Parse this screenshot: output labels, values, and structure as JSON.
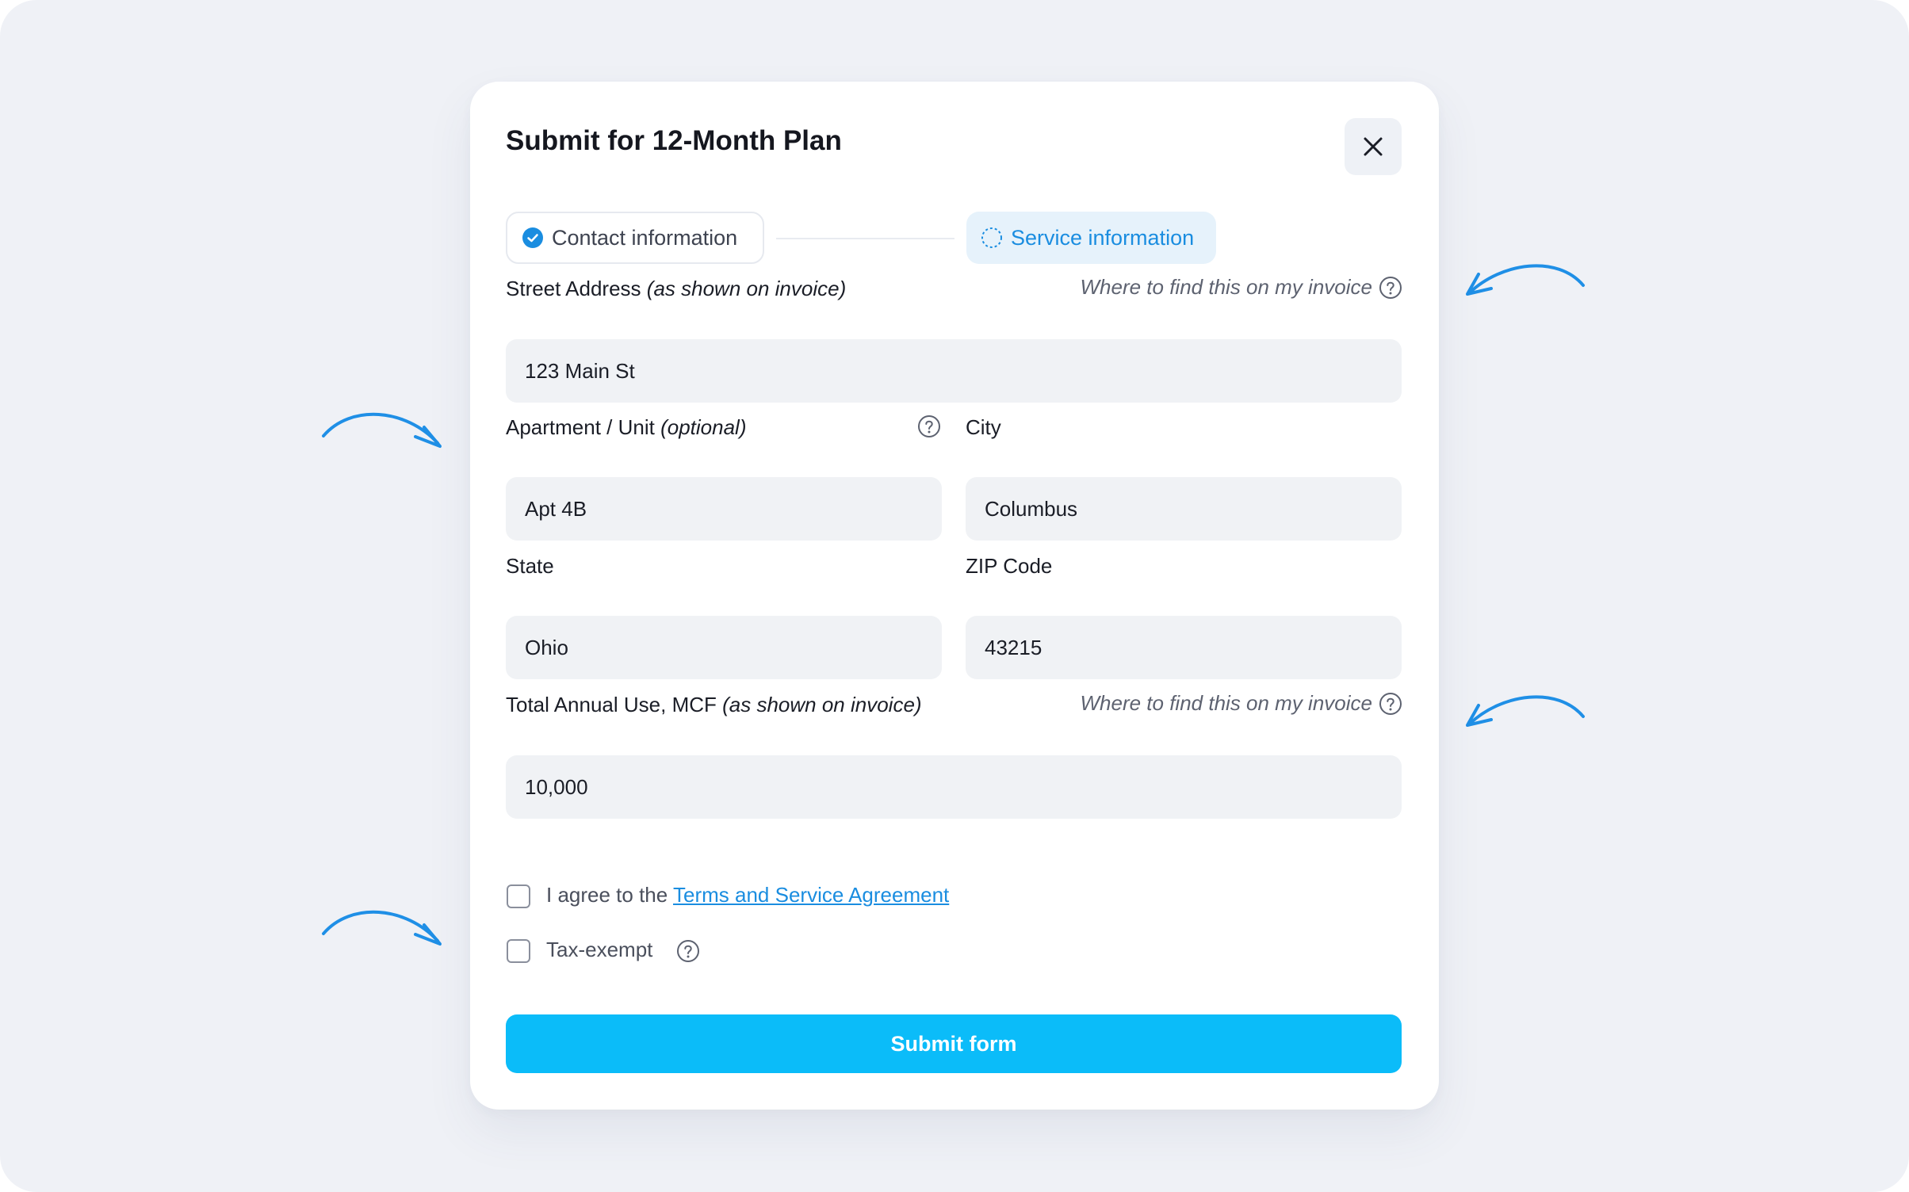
{
  "modal": {
    "title": "Submit for 12-Month Plan",
    "close_icon": "close-icon"
  },
  "steps": [
    {
      "label": "Contact information",
      "status": "complete",
      "icon": "check-circle-icon"
    },
    {
      "label": "Service information",
      "status": "active",
      "icon": "dashed-circle-icon"
    }
  ],
  "form": {
    "street": {
      "label": "Street Address",
      "label_note": "(as shown on invoice)",
      "hint": "Where to find this on my invoice",
      "value": "123 Main St"
    },
    "apartment": {
      "label": "Apartment / Unit",
      "label_note": "(optional)",
      "value": "Apt 4B"
    },
    "city": {
      "label": "City",
      "value": "Columbus"
    },
    "state": {
      "label": "State",
      "value": "Ohio"
    },
    "zip": {
      "label": "ZIP Code",
      "value": "43215"
    },
    "annual_use": {
      "label": "Total Annual Use, MCF",
      "label_note": "(as shown on invoice)",
      "hint": "Where to find this on my invoice",
      "value": "10,000"
    },
    "agree": {
      "prefix": "I agree to the",
      "link": "Terms and Service Agreement",
      "checked": false
    },
    "tax_exempt": {
      "label": "Tax-exempt",
      "checked": false
    },
    "submit_label": "Submit form"
  },
  "colors": {
    "accent": "#1a8de0",
    "submit": "#0bbcf9",
    "field_bg": "#f0f2f5",
    "page_bg": "#eff1f6"
  }
}
